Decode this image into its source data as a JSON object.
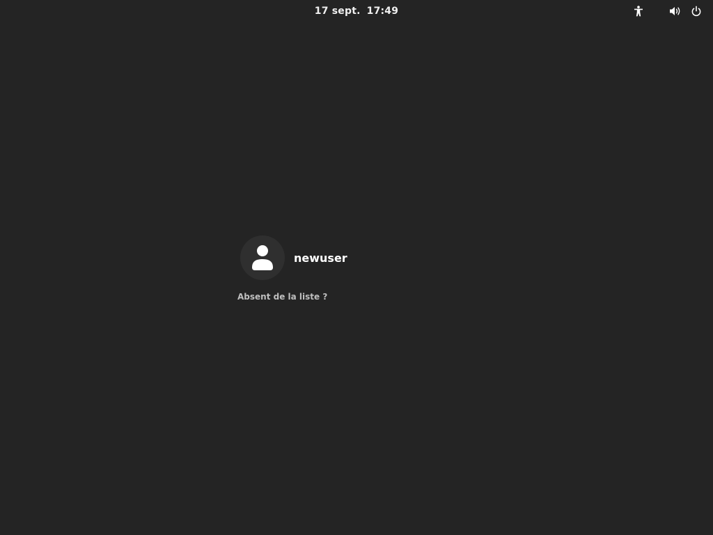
{
  "top_bar": {
    "date": "17 sept.",
    "time": "17:49",
    "icons": [
      "accessibility-icon",
      "volume-icon",
      "power-icon"
    ]
  },
  "login": {
    "users": [
      {
        "name": "newuser",
        "avatar_icon": "avatar-person-icon"
      }
    ],
    "not_listed_label": "Absent de la liste ?"
  },
  "colors": {
    "background": "#242424",
    "avatar_background": "#2f2f2f",
    "text": "#ffffff",
    "secondary_text": "#bfbfbf"
  }
}
